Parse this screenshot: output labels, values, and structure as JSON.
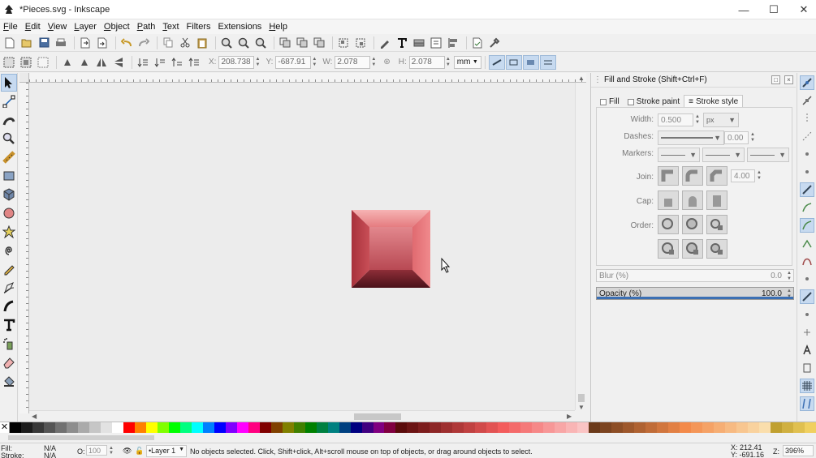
{
  "window": {
    "title": "*Pieces.svg - Inkscape"
  },
  "menu": [
    {
      "ul": "F",
      "rest": "ile"
    },
    {
      "ul": "E",
      "rest": "dit"
    },
    {
      "ul": "V",
      "rest": "iew"
    },
    {
      "ul": "L",
      "rest": "ayer"
    },
    {
      "ul": "O",
      "rest": "bject"
    },
    {
      "ul": "P",
      "rest": "ath"
    },
    {
      "ul": "T",
      "rest": "ext"
    },
    {
      "ul": "",
      "rest": "Filters"
    },
    {
      "ul": "",
      "rest": "Extensions"
    },
    {
      "ul": "H",
      "rest": "elp"
    }
  ],
  "select_toolbar": {
    "x_label": "X:",
    "x_value": "208.738",
    "y_label": "Y:",
    "y_value": "-687.91",
    "w_label": "W:",
    "w_value": "2.078",
    "lock_icon": "lock-icon",
    "h_label": "H:",
    "h_value": "2.078",
    "unit": "mm"
  },
  "dock": {
    "title": "Fill and Stroke (Shift+Ctrl+F)",
    "tabs": {
      "fill": "Fill",
      "stroke_paint": "Stroke paint",
      "stroke_style": "Stroke style"
    },
    "width_label": "Width:",
    "width_value": "0.500",
    "width_unit": "px",
    "dashes_label": "Dashes:",
    "dash_offset": "0.00",
    "markers_label": "Markers:",
    "join_label": "Join:",
    "miter_value": "4.00",
    "cap_label": "Cap:",
    "order_label": "Order:",
    "blur_label": "Blur (%)",
    "blur_value": "0.0",
    "opacity_label": "Opacity (%)",
    "opacity_value": "100.0",
    "opacity_fraction": 1.0
  },
  "status": {
    "fill_label": "Fill:",
    "fill_value": "N/A",
    "stroke_label": "Stroke:",
    "stroke_value": "N/A",
    "opacity_label": "O:",
    "opacity_value": "100",
    "layer": "•Layer 1",
    "message": "No objects selected. Click, Shift+click, Alt+scroll mouse on top of objects, or drag around objects to select.",
    "cursor_x": "X:  212.41",
    "cursor_y": "Y: -691.16",
    "zoom_label": "Z:",
    "zoom_value": "396%"
  },
  "colors": {
    "accent": "#c7daf0",
    "bevel_top": "#f19a9a",
    "bevel_left": "#b33a43",
    "bevel_right": "#e66f74",
    "bevel_bottom": "#5b1b22",
    "bevel_face": "#d66a72"
  }
}
